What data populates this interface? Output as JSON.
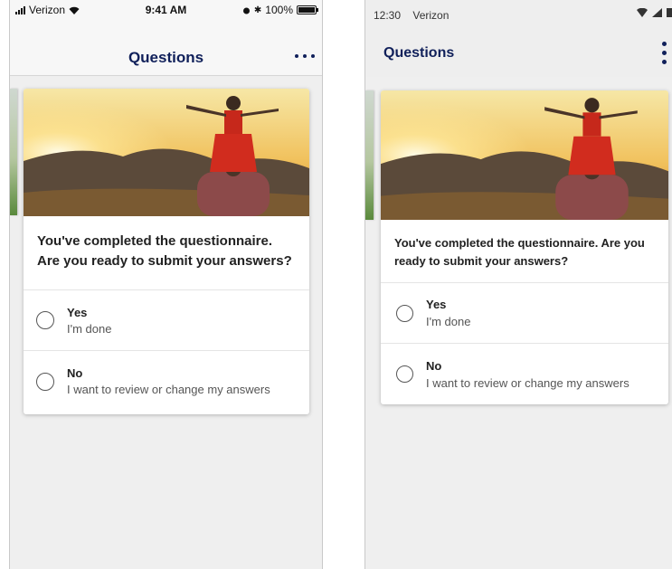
{
  "ios": {
    "status": {
      "carrier": "Verizon",
      "time": "9:41 AM",
      "battery": "100%"
    },
    "nav": {
      "title": "Questions",
      "more_icon": "more-horizontal-icon"
    },
    "card": {
      "question": "You've completed the questionnaire. Are you ready to submit your answers?",
      "options": [
        {
          "title": "Yes",
          "subtitle": "I'm done"
        },
        {
          "title": "No",
          "subtitle": "I want to review or change my answers"
        }
      ]
    }
  },
  "android": {
    "status": {
      "time": "12:30",
      "carrier": "Verizon"
    },
    "nav": {
      "title": "Questions",
      "more_icon": "more-vertical-icon"
    },
    "card": {
      "question": "You've completed the questionnaire. Are you ready to submit your answers?",
      "options": [
        {
          "title": "Yes",
          "subtitle": "I'm done"
        },
        {
          "title": "No",
          "subtitle": "I want to review or change my answers"
        }
      ]
    }
  },
  "colors": {
    "accent": "#10205a",
    "background": "#efefef",
    "card": "#ffffff"
  }
}
